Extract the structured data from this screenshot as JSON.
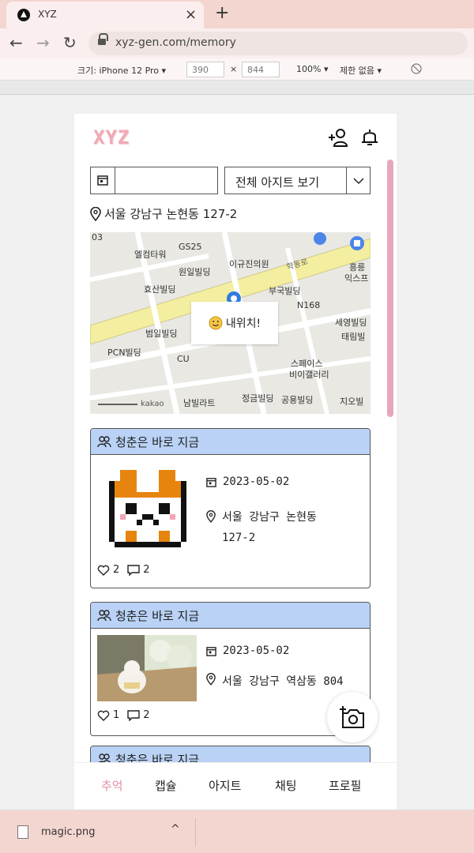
{
  "browser": {
    "tab_title": "XYZ",
    "tab_close": "×",
    "new_tab": "+",
    "url": "xyz-gen.com/memory",
    "back": "←",
    "forward": "→",
    "reload": "↻"
  },
  "devtools": {
    "device": "크기: iPhone 12 Pro ▾",
    "width": "390",
    "x": "×",
    "height": "844",
    "zoom": "100% ▾",
    "throttle": "제한 없음 ▾"
  },
  "app": {
    "logo": "XYZ",
    "accent": "#e58fa2",
    "card_header_color": "#b9d2f5",
    "filter": {
      "date_value": "",
      "select_label": "전체 아지트 보기"
    },
    "current_location": "서울 강남구 논현동 127-2",
    "map": {
      "popup": "내위치!",
      "labels": [
        "엘컴타워",
        "GS25",
        "이규진의원",
        "원일빌딩",
        "효산빌딩",
        "부국빌딩",
        "N168",
        "흥릉",
        "익스프",
        "범일빌딩",
        "세영빌딩",
        "태림빌",
        "PCN빌딩",
        "CU",
        "스페이스",
        "비이갤러리",
        "정금빌딩",
        "공용빌딩",
        "지오빌",
        "남빌라트",
        "kakao",
        "학동로",
        "03"
      ]
    },
    "cards": [
      {
        "title": "청춘은 바로 지금",
        "date": "2023-05-02",
        "location": "서울 강남구 논현동 127-2",
        "likes": "2",
        "comments": "2",
        "image": "hamster-pixel-art"
      },
      {
        "title": "청춘은 바로 지금",
        "date": "2023-05-02",
        "location": "서울 강남구 역삼동 804",
        "likes": "1",
        "comments": "2",
        "image": "dog-photo"
      },
      {
        "title": "청춘은 바로 지금"
      }
    ],
    "nav": [
      "추억",
      "캡슐",
      "아지트",
      "채팅",
      "프로필"
    ]
  },
  "download": {
    "filename": "magic.png",
    "chevron": "^"
  }
}
